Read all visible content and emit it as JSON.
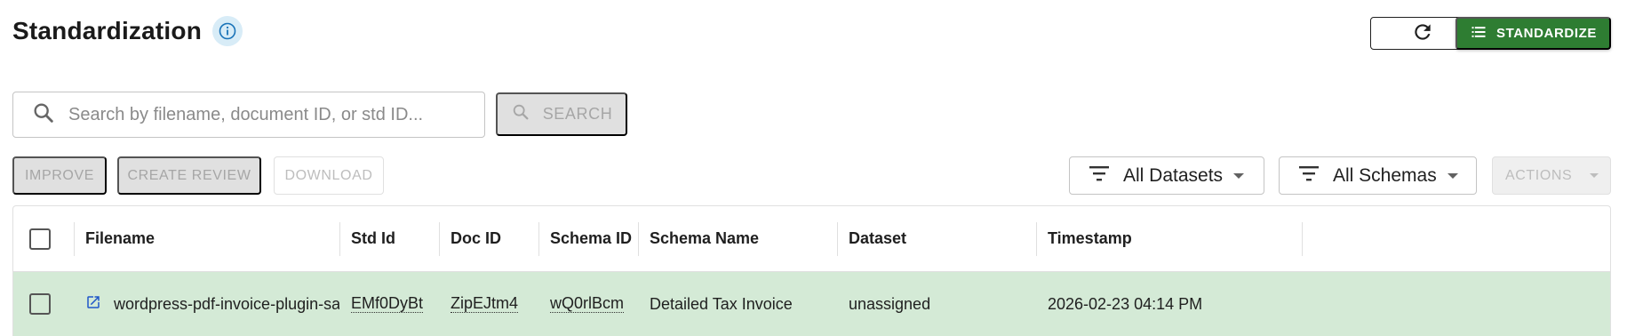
{
  "header": {
    "title": "Standardization",
    "standardize_label": "STANDARDIZE"
  },
  "search": {
    "placeholder": "Search by filename, document ID, or std ID...",
    "button_label": "SEARCH"
  },
  "toolbar": {
    "improve_label": "IMPROVE",
    "create_review_label": "CREATE REVIEW",
    "download_label": "DOWNLOAD",
    "dataset_filter": "All Datasets",
    "schema_filter": "All Schemas",
    "actions_label": "ACTIONS"
  },
  "table": {
    "columns": [
      "Filename",
      "Std Id",
      "Doc ID",
      "Schema ID",
      "Schema Name",
      "Dataset",
      "Timestamp"
    ],
    "rows": [
      {
        "filename": "wordpress-pdf-invoice-plugin-samp",
        "std_id": "EMf0DyBt",
        "doc_id": "ZipEJtm4",
        "schema_id": "wQ0rlBcm",
        "schema_name": "Detailed Tax Invoice",
        "dataset": "unassigned",
        "timestamp": "2026-02-23 04:14 PM"
      }
    ]
  },
  "colors": {
    "primary_green": "#2e7d32",
    "selected_row": "#d4ead6",
    "info_icon_bg": "#d8ecf7",
    "link_blue": "#1e56c8"
  },
  "icons": {
    "info": "info-icon",
    "refresh": "refresh-icon",
    "standardize": "list-icon",
    "search": "search-icon",
    "filter": "filter-icon",
    "open": "external-link-icon"
  }
}
